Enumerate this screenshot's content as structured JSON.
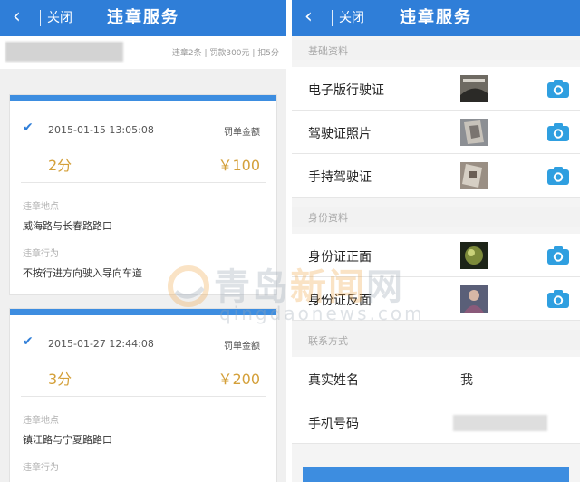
{
  "left": {
    "nav": {
      "back_icon": "‹",
      "close": "关闭",
      "title": "违章服务"
    },
    "summary": "违章2条 | 罚款300元 | 扣5分",
    "records": [
      {
        "datetime": "2015-01-15 13:05:08",
        "fine_label": "罚单金额",
        "points": "2分",
        "amount": "￥100",
        "place_label": "违章地点",
        "place": "威海路与长春路路口",
        "behavior_label": "违章行为",
        "behavior": "不按行进方向驶入导向车道"
      },
      {
        "datetime": "2015-01-27 12:44:08",
        "fine_label": "罚单金额",
        "points": "3分",
        "amount": "￥200",
        "place_label": "违章地点",
        "place": "镇江路与宁夏路路口",
        "behavior_label": "违章行为"
      }
    ]
  },
  "right": {
    "nav": {
      "back_icon": "‹",
      "close": "关闭",
      "title": "违章服务"
    },
    "sections": {
      "basic": "基础资料",
      "identity": "身份资料",
      "contact": "联系方式"
    },
    "rows": {
      "license_ev": "电子版行驶证",
      "license_photo": "驾驶证照片",
      "hold_license": "手持驾驶证",
      "id_front": "身份证正面",
      "id_back": "身份证反面",
      "real_name": "真实姓名",
      "real_name_value": "我",
      "phone": "手机号码"
    },
    "accent": "#2f7ed8"
  },
  "watermark": {
    "brand_a": "青岛",
    "brand_b": "新闻",
    "brand_c": "网",
    "url": "qingdaonews.com"
  }
}
